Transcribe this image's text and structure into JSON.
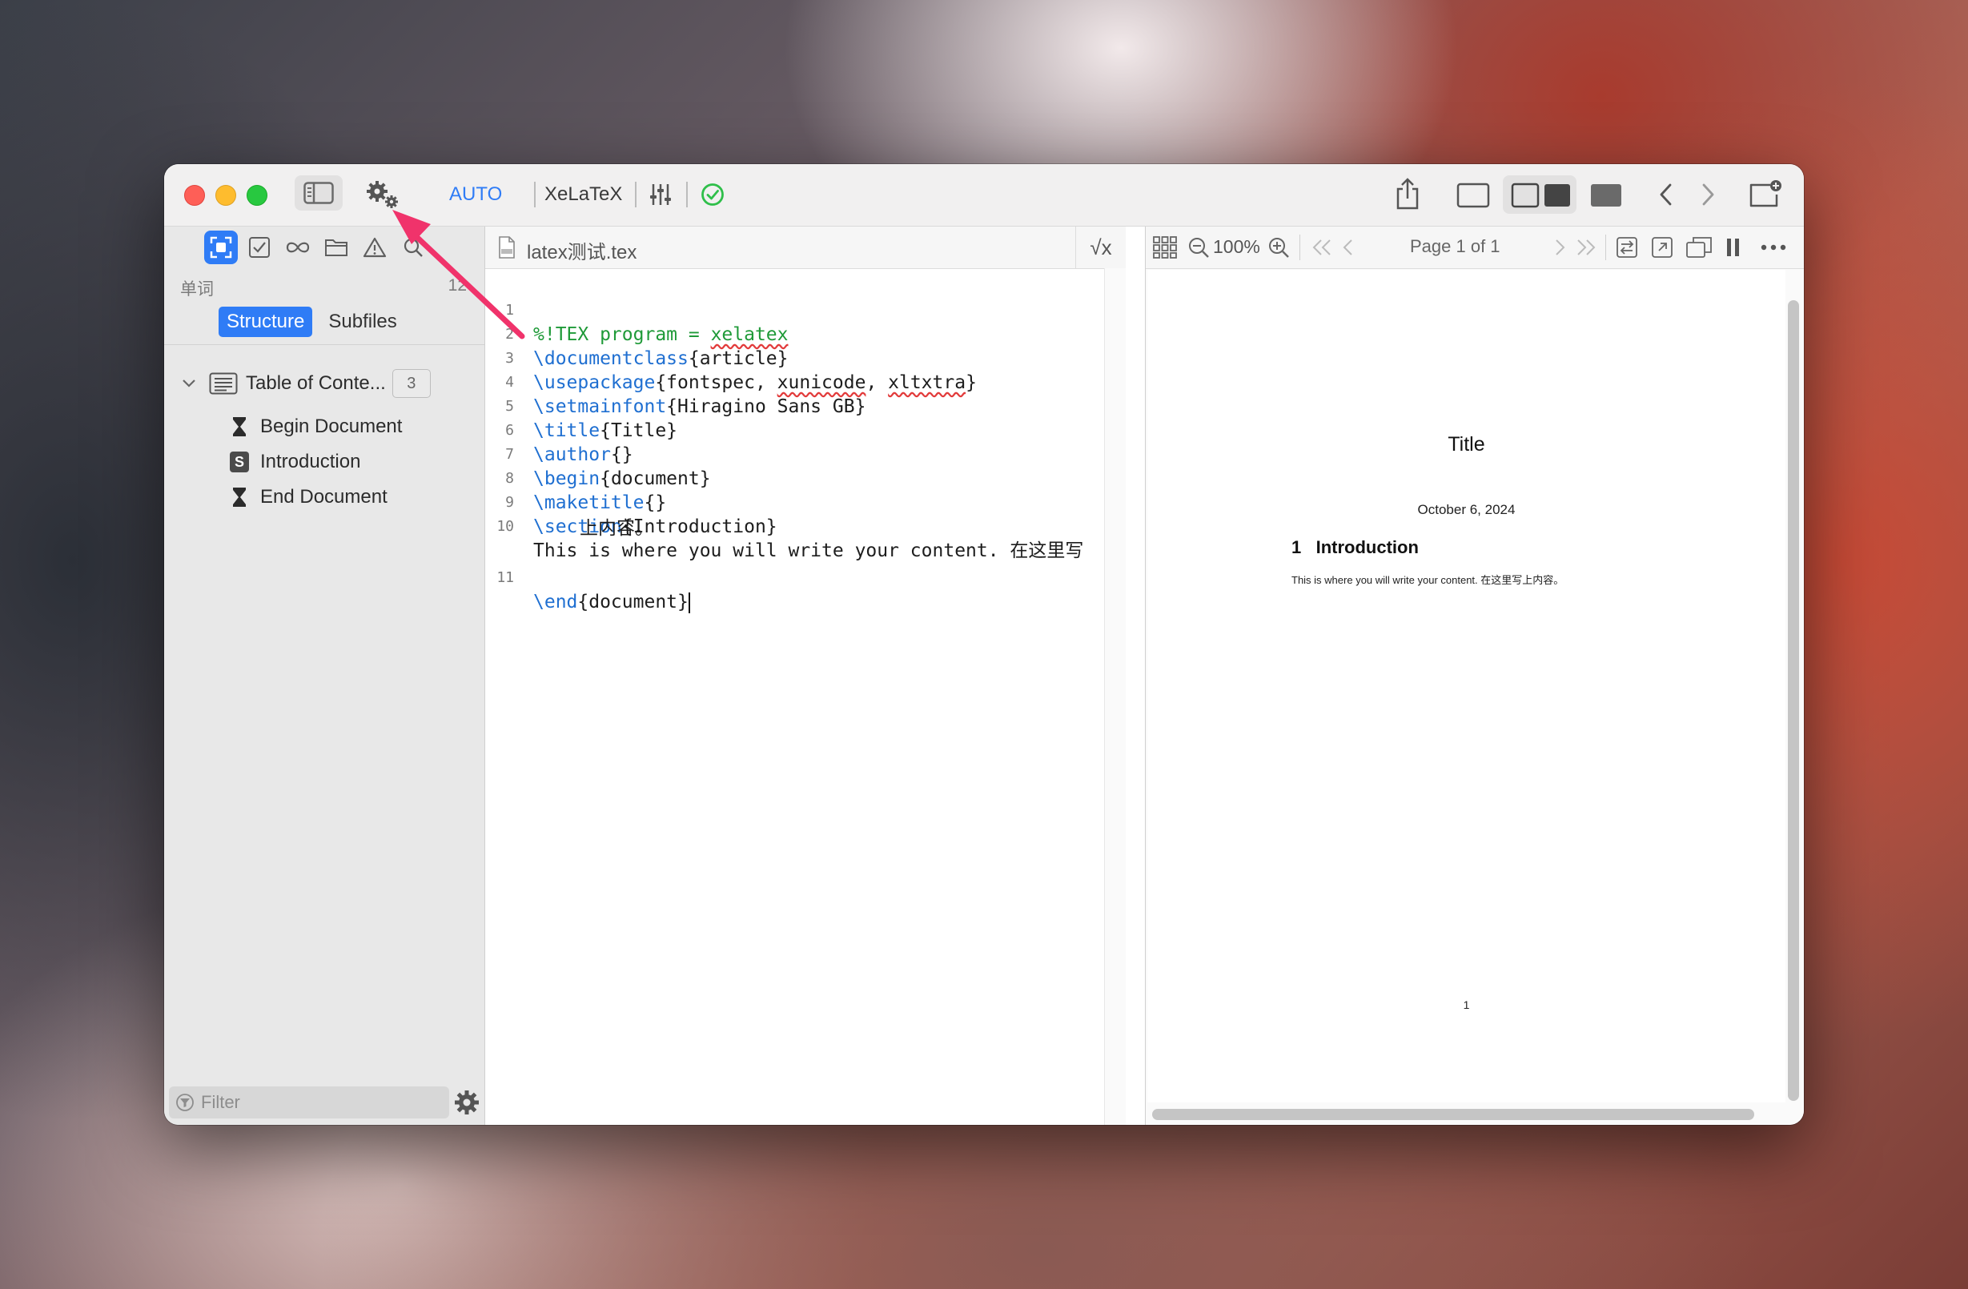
{
  "toolbar": {
    "mode_label": "AUTO",
    "engine_label": "XeLaTeX",
    "icons": [
      "sidebar-toggle-icon",
      "gears-icon",
      "sliders-icon",
      "checkmark-circle-icon",
      "share-icon",
      "layout-editor-icon",
      "layout-split-icon",
      "layout-preview-icon",
      "chevron-left-icon",
      "chevron-right-icon",
      "new-window-icon"
    ]
  },
  "sidebar": {
    "words_label": "单词",
    "words_count": "12",
    "tabs": [
      {
        "label": "Structure",
        "active": true
      },
      {
        "label": "Subfiles",
        "active": false
      }
    ],
    "toc": {
      "label": "Table of Conte...",
      "count": "3"
    },
    "items": [
      {
        "label": "Begin Document",
        "icon": "hourglass-icon"
      },
      {
        "label": "Introduction",
        "icon": "section-s-icon",
        "badge": "S"
      },
      {
        "label": "End Document",
        "icon": "hourglass-icon"
      }
    ],
    "filter_placeholder": "Filter"
  },
  "editor": {
    "file_name": "latex测试.tex",
    "sqrt_label": "√x",
    "lines": [
      {
        "n": "1",
        "text": "%!TEX program = xelatex"
      },
      {
        "n": "2",
        "cmd": "\\documentclass",
        "arg": "{article}"
      },
      {
        "n": "3",
        "cmd": "\\usepackage",
        "arg": "{fontspec, xunicode, xltxtra}"
      },
      {
        "n": "4",
        "cmd": "\\setmainfont",
        "arg": "{Hiragino Sans GB}"
      },
      {
        "n": "5",
        "cmd": "\\title",
        "arg": "{Title}"
      },
      {
        "n": "6",
        "cmd": "\\author",
        "arg": "{}"
      },
      {
        "n": "7",
        "cmd": "\\begin",
        "arg": "{document}"
      },
      {
        "n": "8",
        "cmd": "\\maketitle",
        "arg": "{}"
      },
      {
        "n": "9",
        "cmd": "\\section",
        "arg": "{Introduction}"
      },
      {
        "n": "10",
        "text": "This is where you will write your content. 在这里写",
        "wrap": "上内容。"
      },
      {
        "n": "11",
        "cmd": "\\end",
        "arg": "{document}"
      }
    ]
  },
  "preview": {
    "zoom": "100%",
    "page_label": "Page 1 of 1",
    "pdf": {
      "title": "Title",
      "date": "October 6, 2024",
      "section_number": "1",
      "section_title": "Introduction",
      "body": "This is where you will write your content. 在这里写上内容。",
      "page_number": "1"
    }
  },
  "colors": {
    "accent": "#2f7cf6",
    "comment": "#1f9a38",
    "command": "#1f6fd1",
    "annotation_arrow": "#f0336b"
  }
}
